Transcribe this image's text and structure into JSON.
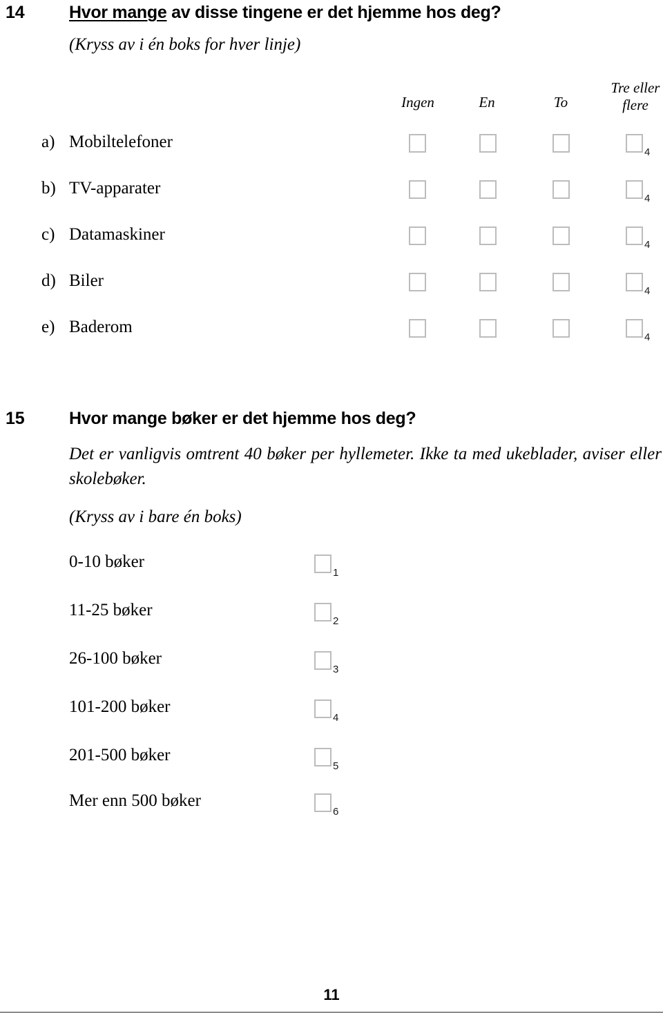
{
  "document": {
    "page_number": "11",
    "checkbox_border_color": "#bcbcbc"
  },
  "question14": {
    "number": "14",
    "heading_underlined": "Hvor mange",
    "heading_rest": " av disse tingene er det hjemme hos deg?",
    "instruction": "(Kryss av i én boks for hver linje)",
    "column_headers": [
      {
        "line1": "Ingen",
        "line2": ""
      },
      {
        "line1": "En",
        "line2": ""
      },
      {
        "line1": "To",
        "line2": ""
      },
      {
        "line1": "Tre eller",
        "line2": "flere"
      }
    ],
    "rows": [
      {
        "letter": "a)",
        "label": "Mobiltelefoner",
        "last_box_subscript": "4"
      },
      {
        "letter": "b)",
        "label": "TV-apparater",
        "last_box_subscript": "4"
      },
      {
        "letter": "c)",
        "label": "Datamaskiner",
        "last_box_subscript": "4"
      },
      {
        "letter": "d)",
        "label": "Biler",
        "last_box_subscript": "4"
      },
      {
        "letter": "e)",
        "label": "Baderom",
        "last_box_subscript": "4"
      }
    ]
  },
  "question15": {
    "number": "15",
    "heading": "Hvor mange bøker er det hjemme hos deg?",
    "helptext": "Det er vanligvis omtrent 40 bøker per hyllemeter. Ikke ta med ukeblader, aviser eller skolebøker.",
    "instruction": "(Kryss av i bare én boks)",
    "options": [
      {
        "label": "0-10 bøker",
        "subscript": "1"
      },
      {
        "label": "11-25 bøker",
        "subscript": "2"
      },
      {
        "label": "26-100 bøker",
        "subscript": "3"
      },
      {
        "label": "101-200 bøker",
        "subscript": "4"
      },
      {
        "label": "201-500 bøker",
        "subscript": "5"
      },
      {
        "label": "Mer enn 500 bøker",
        "subscript": "6"
      }
    ]
  }
}
